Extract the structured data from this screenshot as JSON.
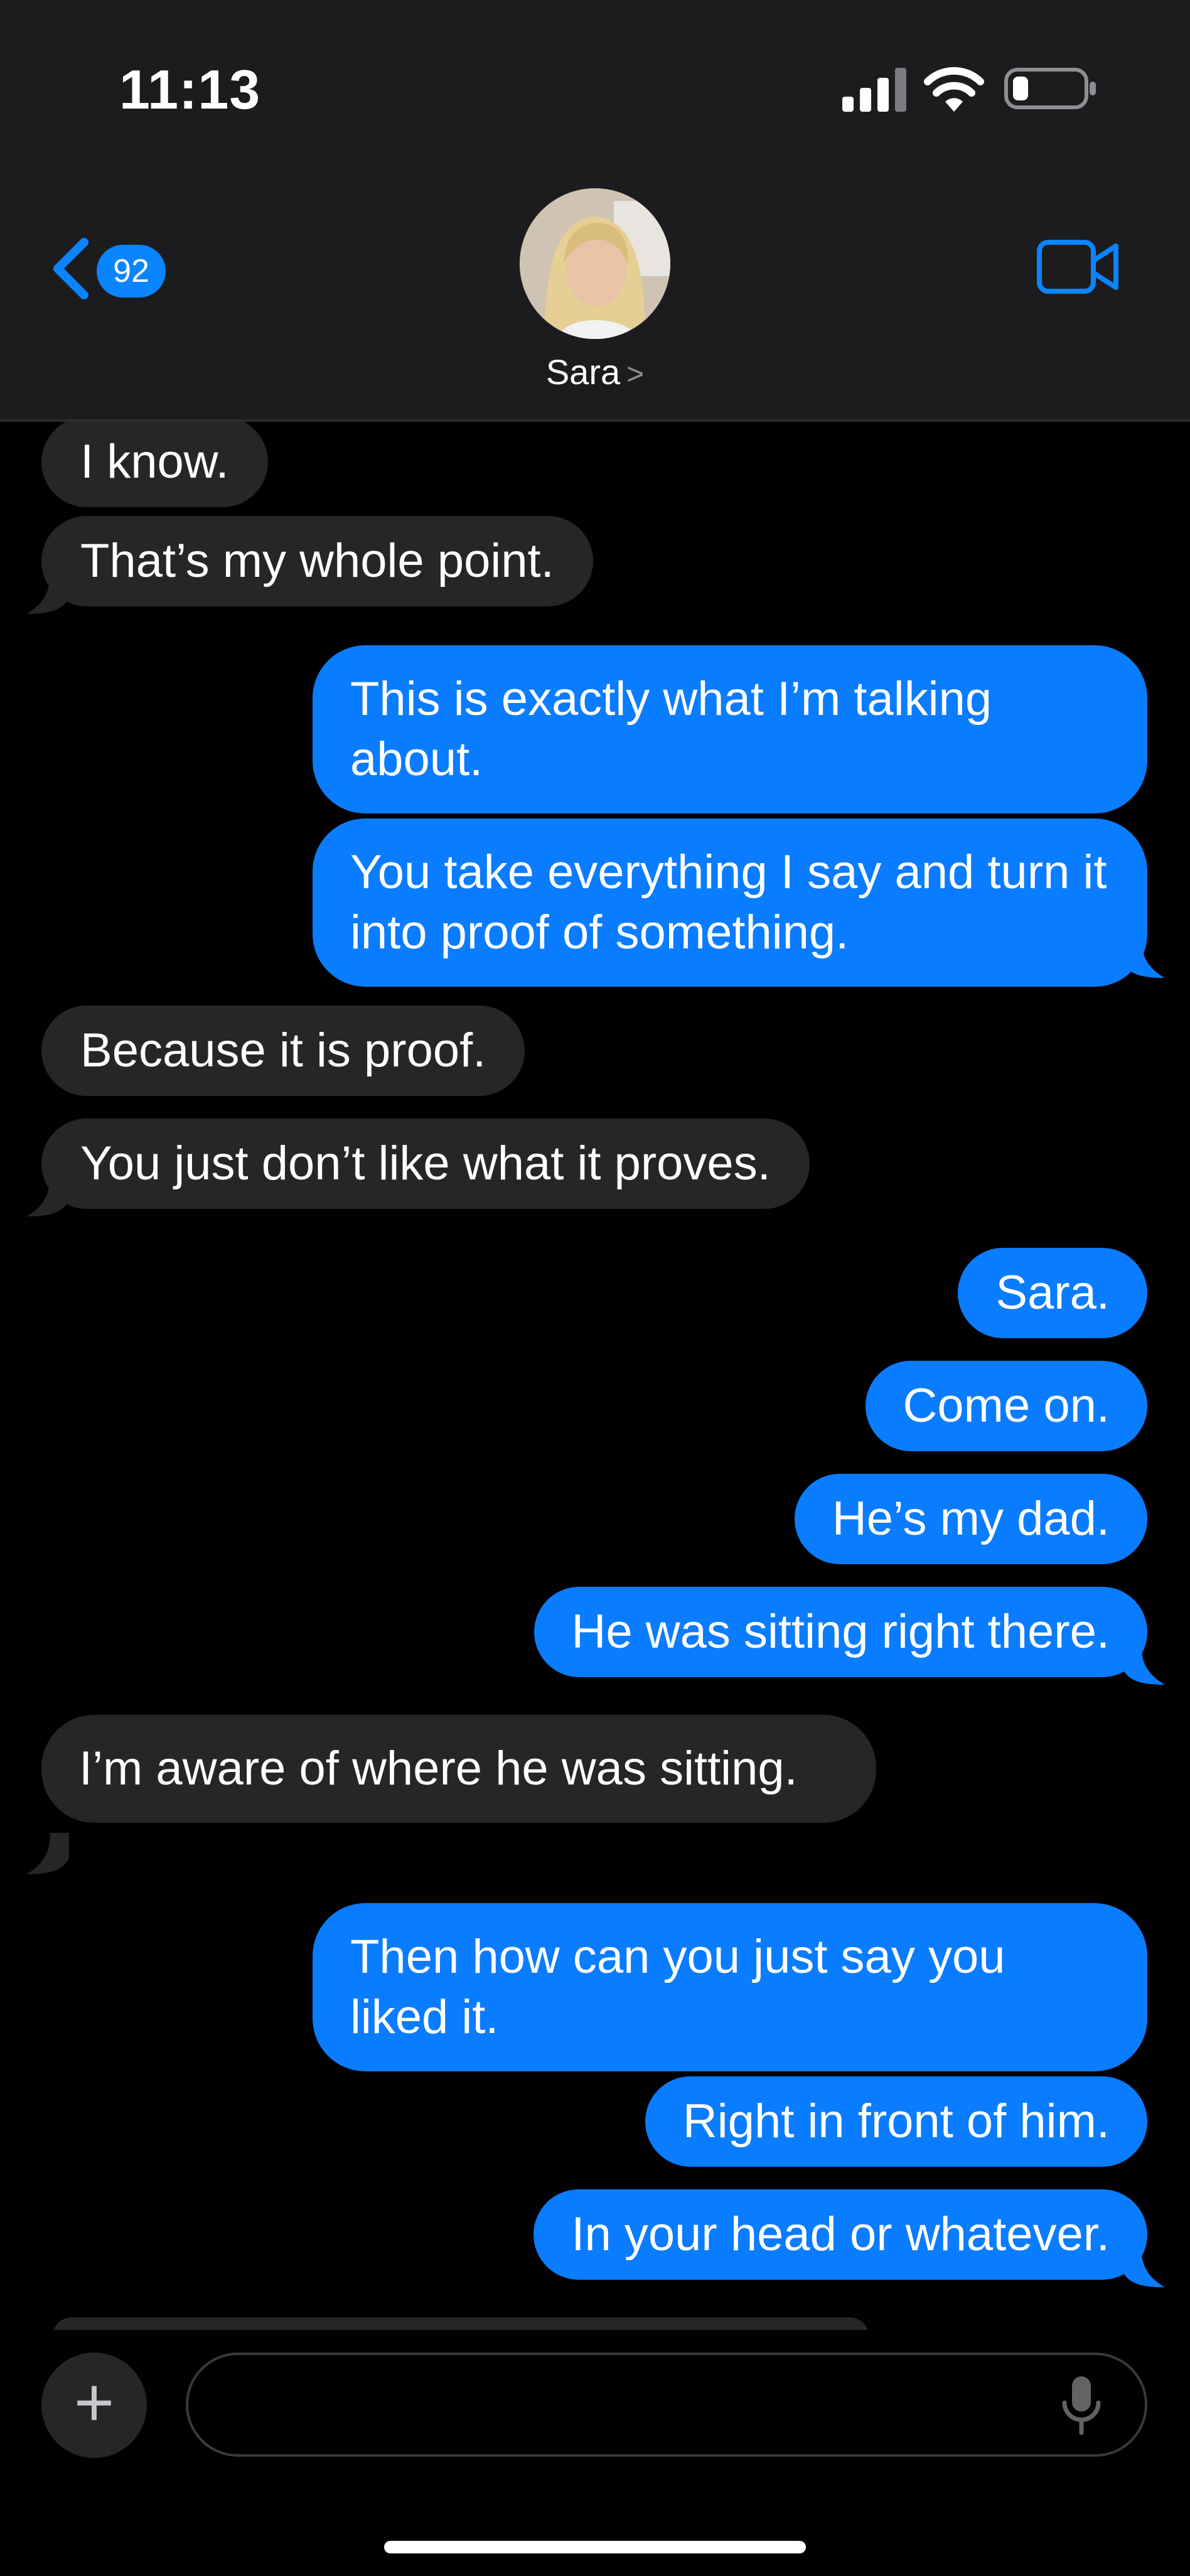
{
  "status_bar": {
    "time": "11:13"
  },
  "header": {
    "back_count": "92",
    "contact_name": "Sara",
    "chevron": ">"
  },
  "messages": [
    {
      "dir": "in",
      "text": "I know."
    },
    {
      "dir": "in",
      "text": "That’s my whole point."
    },
    {
      "dir": "out",
      "text": "This is exactly what I’m talking about."
    },
    {
      "dir": "out",
      "text": "You take everything I say and turn it into proof of something."
    },
    {
      "dir": "in",
      "text": "Because it is proof."
    },
    {
      "dir": "in",
      "text": "You just don’t like what it proves."
    },
    {
      "dir": "out",
      "text": "Sara."
    },
    {
      "dir": "out",
      "text": "Come on."
    },
    {
      "dir": "out",
      "text": "He’s my dad."
    },
    {
      "dir": "out",
      "text": "He was sitting right there."
    },
    {
      "dir": "in",
      "text": "I’m aware of where he was sitting."
    },
    {
      "dir": "out",
      "text": "Then how can you just say you liked it."
    },
    {
      "dir": "out",
      "text": "Right in front of him."
    },
    {
      "dir": "out",
      "text": "In your head or whatever."
    }
  ],
  "input": {
    "placeholder": ""
  },
  "colors": {
    "incoming": "#262628",
    "outgoing": "#0a7cff",
    "accent": "#0a84ff"
  },
  "icons": {
    "back": "chevron-left-icon",
    "video": "video-camera-icon",
    "plus": "plus-icon",
    "mic": "microphone-icon"
  }
}
